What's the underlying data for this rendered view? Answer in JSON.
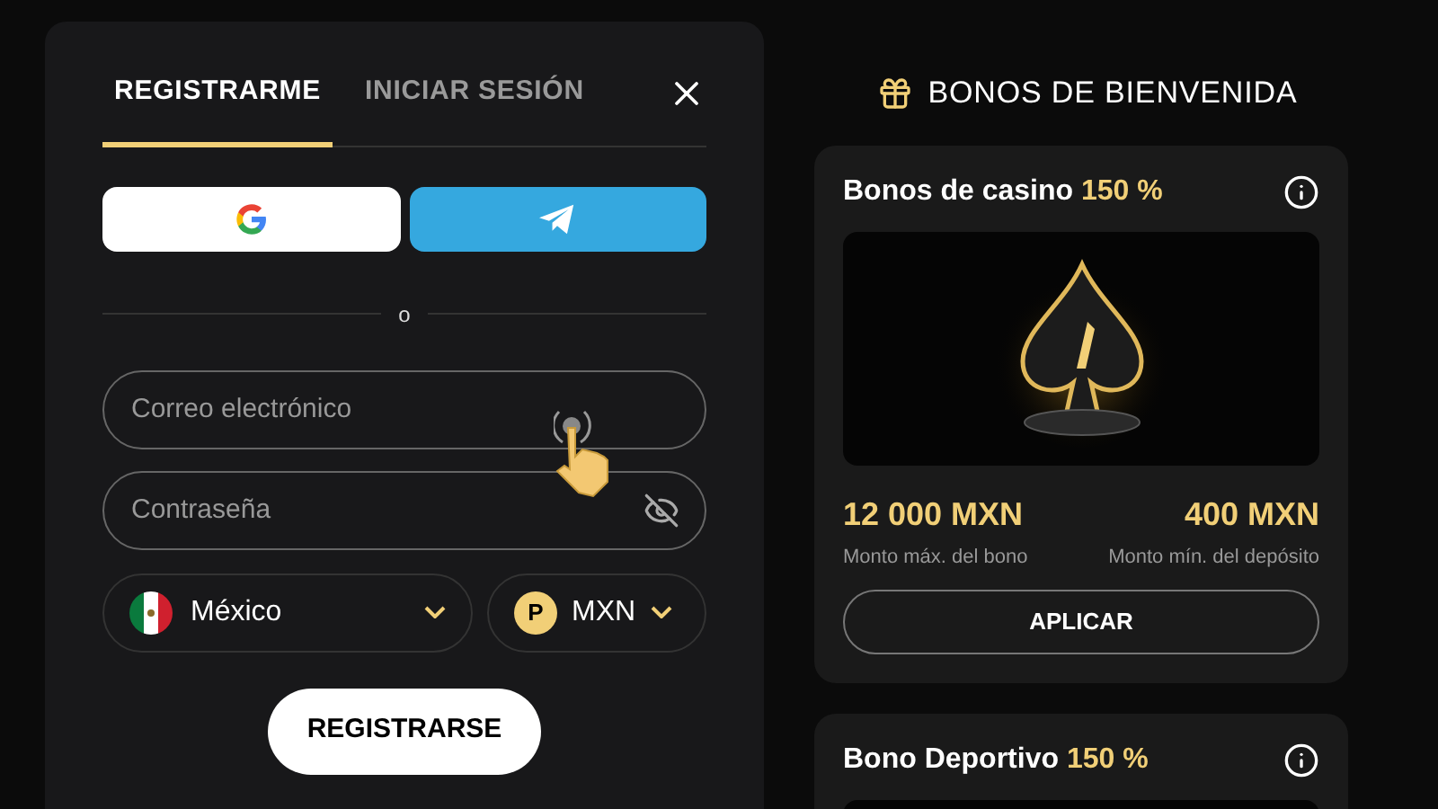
{
  "auth_panel": {
    "tabs": [
      {
        "label": "REGISTRARME",
        "selected": true
      },
      {
        "label": "INICIAR SESIÓN",
        "selected": false
      }
    ],
    "divider_text": "o",
    "email_field": {
      "placeholder": "Correo electrónico"
    },
    "password_field": {
      "placeholder": "Contraseña"
    },
    "country_select": {
      "value": "México"
    },
    "currency_select": {
      "symbol": "P",
      "value": "MXN"
    },
    "submit_button": "REGISTRARSE"
  },
  "bonus_panel": {
    "title": "BONOS DE BIENVENIDA",
    "bonuses": [
      {
        "title": "Bonos de casino",
        "percent": "150 %",
        "max_amount": "12 000 MXN",
        "max_label": "Monto máx. del bono",
        "min_amount": "400 MXN",
        "min_label": "Monto mín. del depósito",
        "button": "APLICAR"
      },
      {
        "title": "Bono Deportivo",
        "percent": "150 %"
      }
    ]
  }
}
